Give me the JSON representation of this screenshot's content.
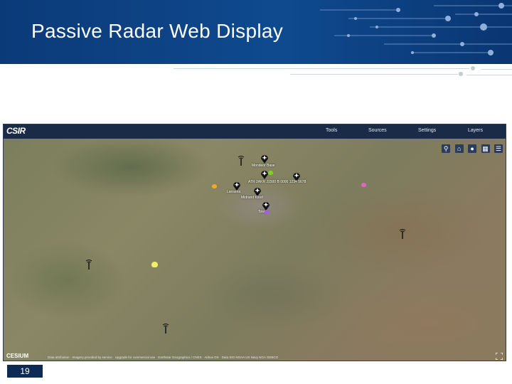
{
  "slide": {
    "title": "Passive Radar Web Display",
    "page_number": "19",
    "header_color": "#0b3a78"
  },
  "app": {
    "logo": "CSIR",
    "nav": [
      "Tools",
      "Sources",
      "Settings",
      "Layers"
    ],
    "map": {
      "toolbar_icons": [
        "search-icon",
        "home-icon",
        "globe-icon",
        "grid-icon",
        "layers-icon"
      ],
      "labels": [
        "Mondeor Base",
        "ATR 2AKR J1500 B 0000 1234 5678",
        "Midrand Kloof",
        "Lanseria",
        "Tower"
      ],
      "cesium_logo": "CESIUM",
      "attribution": "Data attribution · Imagery provided by service · Upgrade for commercial use · Earthstar Geographics / CNES · Airbus DS · Data SIO NOAA US Navy NGA GEBCO"
    },
    "colors": {
      "nav_bg": "#1a2b47",
      "accent_green": "#7ed321",
      "accent_orange": "#f5a623",
      "accent_pink": "#e066c4",
      "accent_yellow": "#f0f060",
      "accent_purple": "#a060e0"
    }
  }
}
